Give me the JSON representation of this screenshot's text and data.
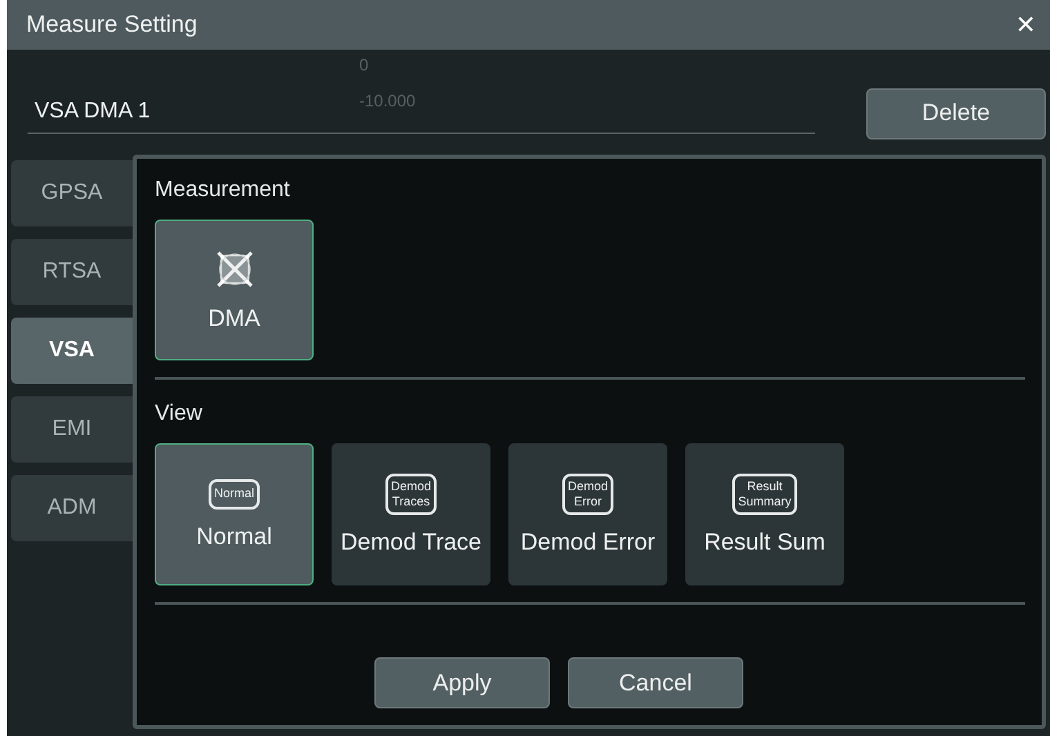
{
  "background": {
    "axis_labels": [
      "0",
      "-10.000"
    ]
  },
  "window": {
    "title": "Measure Setting",
    "close": "✕"
  },
  "name_field": {
    "value": "VSA DMA 1"
  },
  "delete_button": "Delete",
  "tabs": [
    {
      "label": "GPSA",
      "selected": false
    },
    {
      "label": "RTSA",
      "selected": false
    },
    {
      "label": "VSA",
      "selected": true
    },
    {
      "label": "EMI",
      "selected": false
    },
    {
      "label": "ADM",
      "selected": false
    }
  ],
  "measurement": {
    "heading": "Measurement",
    "items": [
      {
        "label": "DMA",
        "selected": true
      }
    ]
  },
  "view": {
    "heading": "View",
    "items": [
      {
        "label": "Normal",
        "badge": "Normal",
        "selected": true
      },
      {
        "label": "Demod Trace",
        "badge": "Demod\nTraces",
        "selected": false
      },
      {
        "label": "Demod Error",
        "badge": "Demod\nError",
        "selected": false
      },
      {
        "label": "Result Sum",
        "badge": "Result\nSummary",
        "selected": false
      }
    ]
  },
  "buttons": [
    "Apply",
    "Cancel"
  ]
}
